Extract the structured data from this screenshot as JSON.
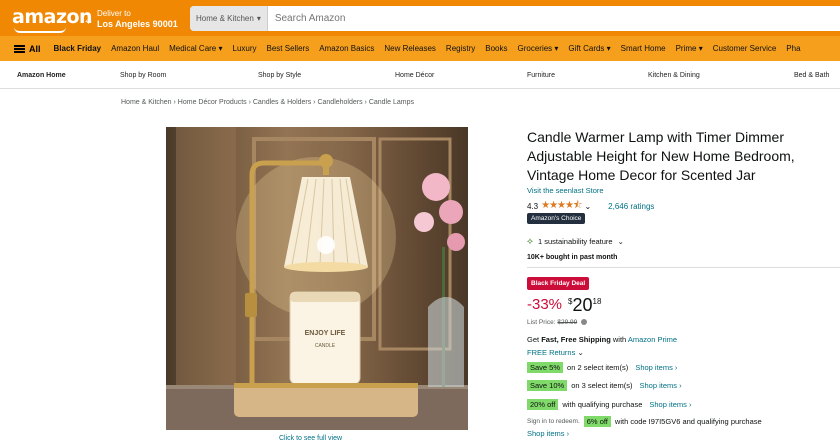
{
  "header": {
    "logo_text": "amazon",
    "deliver_line1": "Deliver to",
    "deliver_line2": "Los Angeles 90001",
    "search_category": "Home & Kitchen",
    "search_placeholder": "Search Amazon"
  },
  "nav": {
    "all_label": "All",
    "items": [
      "Black Friday",
      "Amazon Haul",
      "Medical Care ▾",
      "Luxury",
      "Best Sellers",
      "Amazon Basics",
      "New Releases",
      "Registry",
      "Books",
      "Groceries ▾",
      "Gift Cards ▾",
      "Smart Home",
      "Prime ▾",
      "Customer Service",
      "Pha"
    ]
  },
  "subnav": {
    "items": [
      "Amazon Home",
      "Shop by Room",
      "Shop by Style",
      "Home Décor",
      "Furniture",
      "Kitchen & Dining",
      "Bed & Bath"
    ]
  },
  "breadcrumb": "Home & Kitchen › Home Décor Products › Candles & Holders › Candleholders › Candle Lamps",
  "gallery": {
    "caption": "Click to see full view",
    "candle_label_1": "ENJOY LIFE",
    "candle_label_2": "CANDLE"
  },
  "product": {
    "title": "Candle Warmer Lamp with Timer Dimmer Adjustable Height for New Home Bedroom, Vintage Home Decor for Scented Jar",
    "store_link": "Visit the seenlast Store",
    "rating": "4.3",
    "stars": "★★★★⯪",
    "ratings_count": "2,646 ratings",
    "choice_badge": "Amazon's Choice",
    "sustainability": "1 sustainability feature",
    "bought": "10K+ bought in past month",
    "deal_badge": "Black Friday Deal",
    "discount": "-33%",
    "currency": "$",
    "price_whole": "20",
    "price_fraction": "18",
    "list_price_label": "List Price:",
    "list_price": "$29.99",
    "shipping_prefix": "Get ",
    "shipping_bold": "Fast, Free Shipping",
    "shipping_mid": " with ",
    "shipping_link": "Amazon Prime",
    "returns": "FREE Returns",
    "promos": [
      {
        "badge": "Save 5%",
        "text": "on 2 select item(s)",
        "link": "Shop items ›"
      },
      {
        "badge": "Save 10%",
        "text": "on 3 select item(s)",
        "link": "Shop items ›"
      },
      {
        "badge": "20% off",
        "text": "with qualifying purchase",
        "link": "Shop items ›"
      }
    ],
    "signin_text": "Sign in to redeem.",
    "coupon_badge": "6% off",
    "coupon_text": "with code I97I5GV6 and qualifying purchase",
    "coupon_link": "Shop items ›"
  }
}
